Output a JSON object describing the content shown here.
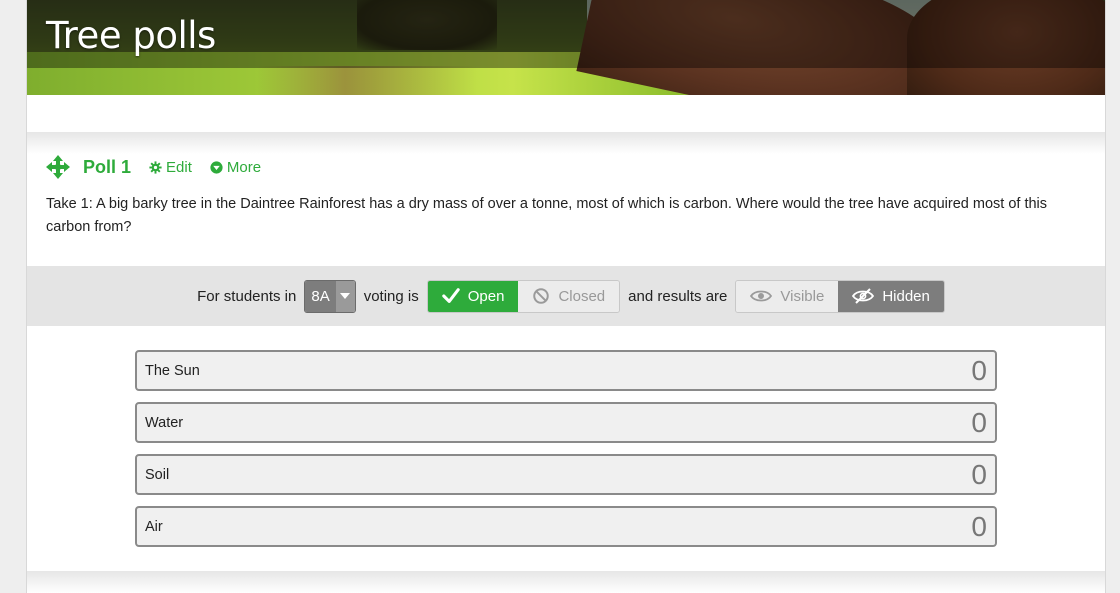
{
  "banner": {
    "title": "Tree polls"
  },
  "poll": {
    "title": "Poll 1",
    "edit_label": "Edit",
    "more_label": "More",
    "question": "Take 1: A big barky tree in the Daintree Rainforest has a dry mass of over a tonne, most of which is carbon. Where would the tree have acquired most of this carbon from?"
  },
  "controls": {
    "prefix": "For students in",
    "class_value": "8A",
    "voting_label": "voting is",
    "open_label": "Open",
    "closed_label": "Closed",
    "results_label": "and results are",
    "visible_label": "Visible",
    "hidden_label": "Hidden",
    "voting_state": "Open",
    "results_state": "Hidden"
  },
  "answers": [
    {
      "label": "The Sun",
      "count": "0"
    },
    {
      "label": "Water",
      "count": "0"
    },
    {
      "label": "Soil",
      "count": "0"
    },
    {
      "label": "Air",
      "count": "0"
    }
  ],
  "colors": {
    "accent_green": "#2eab3b",
    "toggle_gray": "#7d7d7d",
    "bar_bg": "#e4e4e4"
  },
  "icons": {
    "move": "move-arrows-icon",
    "edit": "gear-icon",
    "more": "chevron-down-circle-icon",
    "open": "check-icon",
    "closed": "no-entry-icon",
    "visible": "eye-icon",
    "hidden": "eye-slash-icon",
    "select": "caret-down-icon"
  }
}
